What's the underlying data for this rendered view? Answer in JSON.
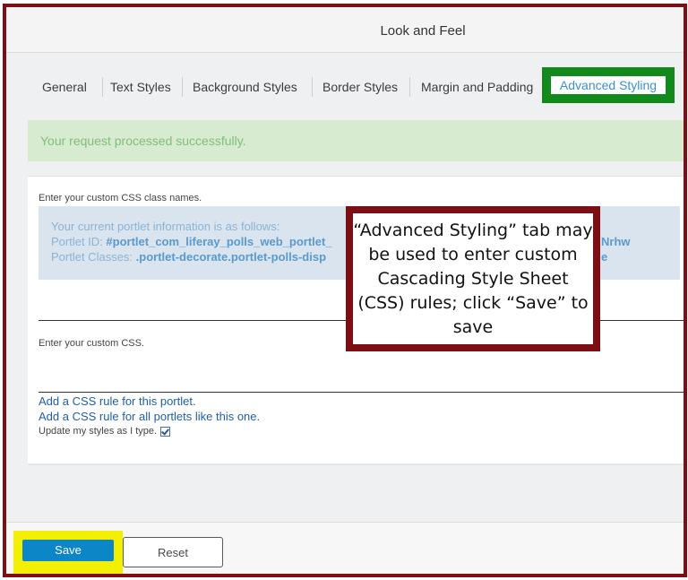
{
  "header": {
    "title": "Look and Feel"
  },
  "tabs": [
    {
      "label": "General"
    },
    {
      "label": "Text Styles"
    },
    {
      "label": "Background Styles"
    },
    {
      "label": "Border Styles"
    },
    {
      "label": "Margin and Padding"
    },
    {
      "label": "Advanced Styling",
      "active": true
    }
  ],
  "alert": {
    "text": "Your request processed successfully."
  },
  "form": {
    "class_names_label": "Enter your custom CSS class names.",
    "info_intro": "Your current portlet information is as follows:",
    "portlet_id_label": "Portlet ID:",
    "portlet_id_value": "#portlet_com_liferay_polls_web_portlet_",
    "portlet_id_value_tail": "Nrhw",
    "portlet_classes_label": "Portlet Classes:",
    "portlet_classes_value": ".portlet-decorate.portlet-polls-disp",
    "portlet_classes_value_tail": "e",
    "custom_css_label": "Enter your custom CSS.",
    "link_this_portlet": "Add a CSS rule for this portlet.",
    "link_all_portlets": "Add a CSS rule for all portlets like this one.",
    "update_styles_label": "Update my styles as I type."
  },
  "callout": {
    "text": "“Advanced Styling” tab may be used to enter custom Cascading Style Sheet (CSS) rules; click “Save” to save"
  },
  "footer": {
    "save_label": "Save",
    "reset_label": "Reset"
  },
  "colors": {
    "frame_border": "#7b0f14",
    "active_tab_highlight": "#118a1b",
    "save_highlight": "#f2ef00",
    "save_button": "#0d86c8",
    "alert_bg": "#d7ebd1"
  }
}
